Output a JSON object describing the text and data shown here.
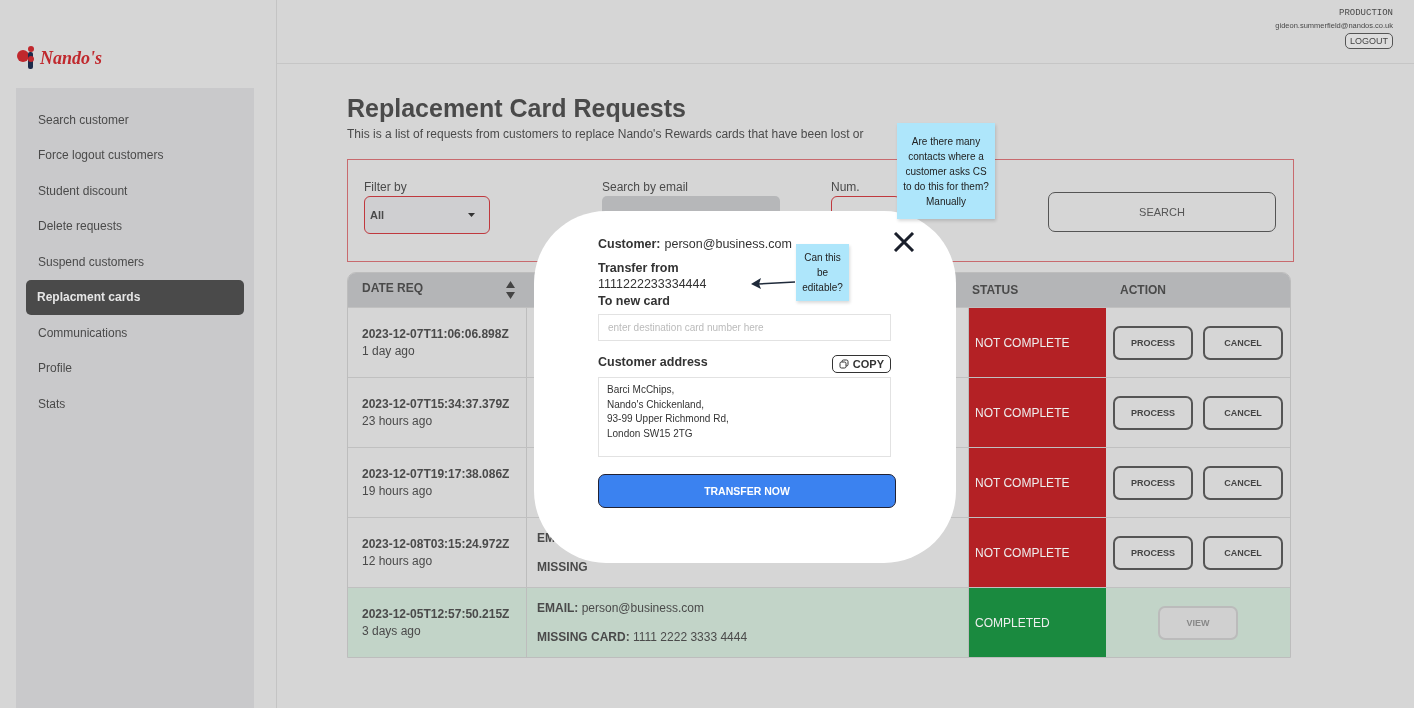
{
  "brand": {
    "name": "Nando's"
  },
  "sidebar": {
    "items": [
      {
        "label": "Search customer",
        "selected": false
      },
      {
        "label": "Force logout customers",
        "selected": false
      },
      {
        "label": "Student discount",
        "selected": false
      },
      {
        "label": "Delete requests",
        "selected": false
      },
      {
        "label": "Suspend customers",
        "selected": false
      },
      {
        "label": "Replacment cards",
        "selected": true
      },
      {
        "label": "Communications",
        "selected": false
      },
      {
        "label": "Profile",
        "selected": false
      },
      {
        "label": "Stats",
        "selected": false
      }
    ]
  },
  "account": {
    "environment": "PRODUCTION",
    "email": "gideon.summerfield@nandos.co.uk",
    "logout": "LOGOUT"
  },
  "page": {
    "title": "Replacement Card Requests",
    "subtitle": "This is a list of requests from customers to replace Nando's Rewards cards that have been lost or"
  },
  "filters": {
    "filter_label": "Filter by",
    "filter_value": "All",
    "email_label": "Search by email",
    "num_label": "Num.",
    "search_button": "SEARCH"
  },
  "table": {
    "columns": [
      "DATE REQ",
      "STATUS",
      "ACTION"
    ],
    "rows": [
      {
        "date": "2023-12-07T11:06:06.898Z",
        "ago": "1 day ago",
        "details": [],
        "status": "NOT COMPLETE",
        "complete": false,
        "actions": [
          {
            "label": "PROCESS",
            "disabled": false
          },
          {
            "label": "CANCEL",
            "disabled": false
          }
        ]
      },
      {
        "date": "2023-12-07T15:34:37.379Z",
        "ago": "23 hours ago",
        "details": [],
        "status": "NOT COMPLETE",
        "complete": false,
        "actions": [
          {
            "label": "PROCESS",
            "disabled": false
          },
          {
            "label": "CANCEL",
            "disabled": false
          }
        ]
      },
      {
        "date": "2023-12-07T19:17:38.086Z",
        "ago": "19 hours ago",
        "details": [],
        "status": "NOT COMPLETE",
        "complete": false,
        "actions": [
          {
            "label": "PROCESS",
            "disabled": false
          },
          {
            "label": "CANCEL",
            "disabled": false
          }
        ]
      },
      {
        "date": "2023-12-08T03:15:24.972Z",
        "ago": "12 hours ago",
        "details": [
          {
            "label": "EM"
          },
          {
            "label": "MISSING"
          }
        ],
        "status": "NOT COMPLETE",
        "complete": false,
        "actions": [
          {
            "label": "PROCESS",
            "disabled": false
          },
          {
            "label": "CANCEL",
            "disabled": false
          }
        ]
      },
      {
        "date": "2023-12-05T12:57:50.215Z",
        "ago": "3 days ago",
        "details": [
          {
            "label": "EMAIL:",
            "value": "person@business.com"
          },
          {
            "label": "MISSING CARD:",
            "value": "1111 2222 3333 4444"
          }
        ],
        "status": "COMPLETED",
        "complete": true,
        "actions": [
          {
            "label": "VIEW",
            "disabled": true
          }
        ]
      }
    ]
  },
  "modal": {
    "customer_label": "Customer:",
    "customer": "person@business.com",
    "from_label": "Transfer from",
    "from_value": "1111222233334444",
    "to_label": "To new card",
    "to_placeholder": "enter destination card number here",
    "address_label": "Customer address",
    "copy_button": "COPY",
    "address_lines": [
      "Barci McChips,",
      "Nando's Chickenland,",
      "93-99 Upper Richmond Rd,",
      "London SW15 2TG"
    ],
    "submit": "TRANSFER NOW"
  },
  "notes": [
    {
      "text": "Are there many contacts where a customer asks CS to do this for them? Manually"
    },
    {
      "text": "Can this be editable?"
    }
  ]
}
